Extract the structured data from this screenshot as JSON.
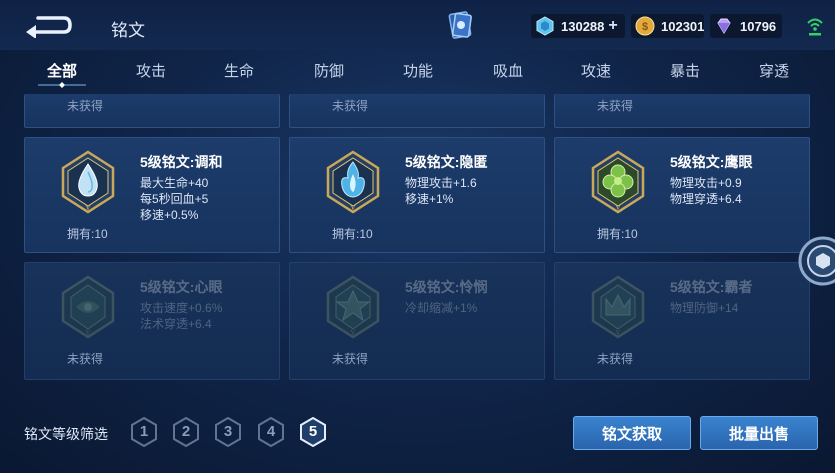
{
  "header": {
    "title": "铭文",
    "currencies": [
      {
        "name": "diamond-icon",
        "value": "130288",
        "color": "#5fc4f0"
      },
      {
        "name": "gold-coin-icon",
        "value": "102301",
        "color": "#e2a93d"
      },
      {
        "name": "gem-icon",
        "value": "10796",
        "color": "#b99ef5"
      }
    ]
  },
  "tabs": [
    "全部",
    "攻击",
    "生命",
    "防御",
    "功能",
    "吸血",
    "攻速",
    "暴击",
    "穿透"
  ],
  "top_row": [
    {
      "status": "未获得"
    },
    {
      "status": "未获得"
    },
    {
      "status": "未获得"
    }
  ],
  "owned": [
    {
      "name": "5级铭文:调和",
      "stats": [
        "最大生命+40",
        "每5秒回血+5",
        "移速+0.5%"
      ],
      "status": "拥有:10",
      "icon": "teardrop-rune-icon"
    },
    {
      "name": "5级铭文:隐匿",
      "stats": [
        "物理攻击+1.6",
        "移速+1%"
      ],
      "status": "拥有:10",
      "icon": "flame-rune-icon"
    },
    {
      "name": "5级铭文:鹰眼",
      "stats": [
        "物理攻击+0.9",
        "物理穿透+6.4"
      ],
      "status": "拥有:10",
      "icon": "clover-rune-icon"
    }
  ],
  "locked": [
    {
      "name": "5级铭文:心眼",
      "stats": [
        "攻击速度+0.6%",
        "法术穿透+6.4"
      ],
      "status": "未获得",
      "icon": "eye-rune-icon"
    },
    {
      "name": "5级铭文:怜悯",
      "stats": [
        "冷却缩减+1%"
      ],
      "status": "未获得",
      "icon": "star-rune-icon"
    },
    {
      "name": "5级铭文:霸者",
      "stats": [
        "物理防御+14"
      ],
      "status": "未获得",
      "icon": "crown-rune-icon"
    }
  ],
  "footer": {
    "filter_label": "铭文等级筛选",
    "levels": [
      "1",
      "2",
      "3",
      "4",
      "5"
    ],
    "acquire_label": "铭文获取",
    "sell_label": "批量出售"
  },
  "colors": {
    "accent": "#3a83cf",
    "background": "#10254a"
  }
}
